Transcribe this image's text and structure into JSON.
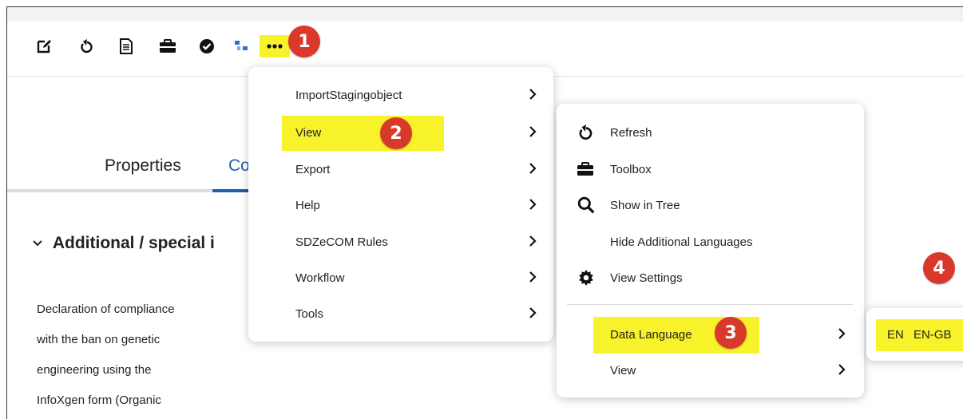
{
  "toolbar": {
    "icons": [
      "edit-icon",
      "refresh-icon",
      "document-icon",
      "toolbox-icon",
      "check-circle-icon",
      "hierarchy-icon",
      "more-icon"
    ]
  },
  "badges": {
    "one": "1",
    "two": "2",
    "three": "3",
    "four": "4"
  },
  "tabs": {
    "properties": "Properties",
    "second_partial": "Co"
  },
  "section": {
    "heading": "Additional / special i",
    "lines": [
      "Declaration of compliance",
      "with the ban on genetic",
      "engineering using the",
      "InfoXgen form (Organic"
    ]
  },
  "menu1": {
    "items": [
      {
        "label": "ImportStagingobject"
      },
      {
        "label": "View"
      },
      {
        "label": "Export"
      },
      {
        "label": "Help"
      },
      {
        "label": "SDZeCOM Rules"
      },
      {
        "label": "Workflow"
      },
      {
        "label": "Tools"
      }
    ]
  },
  "menu2": {
    "items": [
      {
        "label": "Refresh",
        "icon": "refresh-icon"
      },
      {
        "label": "Toolbox",
        "icon": "toolbox-icon"
      },
      {
        "label": "Show in Tree",
        "icon": "search-icon"
      },
      {
        "label": "Hide Additional Languages",
        "icon": ""
      },
      {
        "label": "View Settings",
        "icon": "gear-icon"
      },
      {
        "label": "Data Language",
        "icon": ""
      },
      {
        "label": "View",
        "icon": ""
      }
    ]
  },
  "menu3": {
    "items": [
      {
        "label": "EN"
      },
      {
        "label": "EN-GB"
      }
    ]
  },
  "colors": {
    "highlight": "#f8f22a",
    "badge": "#d9392b",
    "active_tab": "#1f5ea8"
  }
}
